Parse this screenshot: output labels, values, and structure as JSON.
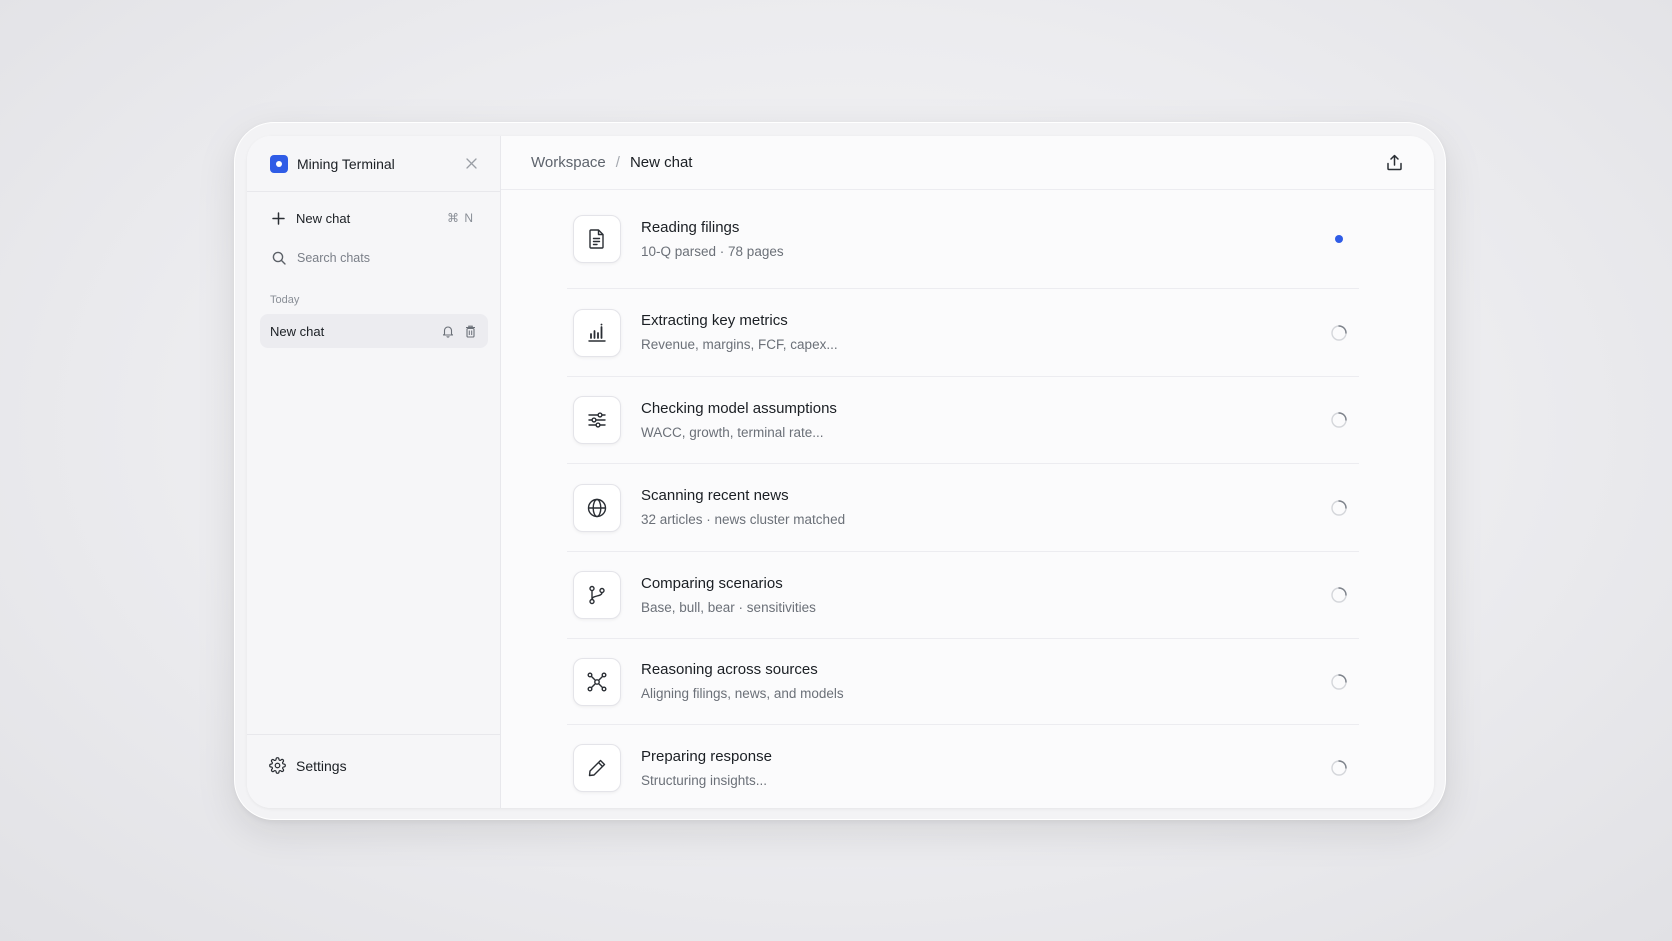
{
  "sidebar": {
    "app_title": "Mining Terminal",
    "new_chat_label": "New chat",
    "new_chat_shortcut": "⌘ N",
    "search_placeholder": "Search chats",
    "section_label": "Today",
    "chats": [
      {
        "label": "New chat",
        "active": true
      }
    ],
    "settings_label": "Settings"
  },
  "header": {
    "breadcrumb": [
      "Workspace",
      "New chat"
    ],
    "separator": "/"
  },
  "steps": [
    {
      "title": "Reading filings",
      "subtitle": "10-Q parsed · 78 pages",
      "icon": "document-icon",
      "status": "active"
    },
    {
      "title": "Extracting key metrics",
      "subtitle": "Revenue, margins, FCF, capex...",
      "icon": "bar-chart-icon",
      "status": "pending"
    },
    {
      "title": "Checking model assumptions",
      "subtitle": "WACC, growth, terminal rate...",
      "icon": "sliders-icon",
      "status": "pending"
    },
    {
      "title": "Scanning recent news",
      "subtitle": "32 articles · news cluster matched",
      "icon": "globe-icon",
      "status": "pending"
    },
    {
      "title": "Comparing scenarios",
      "subtitle": "Base, bull, bear · sensitivities",
      "icon": "git-branch-icon",
      "status": "pending"
    },
    {
      "title": "Reasoning across sources",
      "subtitle": "Aligning filings, news, and models",
      "icon": "network-icon",
      "status": "pending"
    },
    {
      "title": "Preparing response",
      "subtitle": "Structuring insights...",
      "icon": "pencil-icon",
      "status": "pending"
    }
  ],
  "colors": {
    "accent": "#2f5ce6",
    "active_dot": "#2f5ce6"
  }
}
